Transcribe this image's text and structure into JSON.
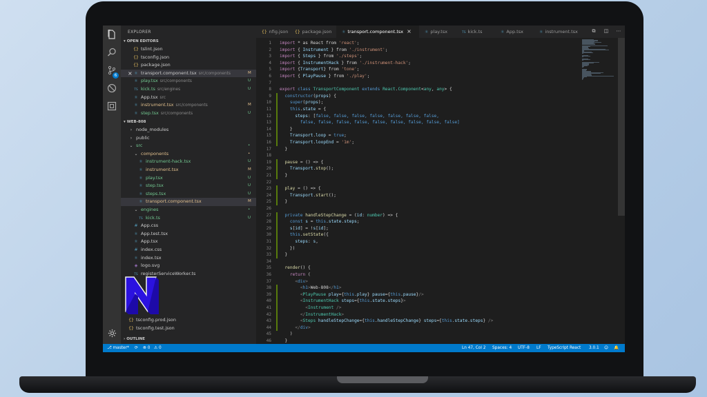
{
  "sidebar": {
    "title": "EXPLORER",
    "open_editors_label": "OPEN EDITORS",
    "open_editors": [
      {
        "icon": "{}",
        "name": "tslint.json",
        "desc": "",
        "status": "",
        "sel": false,
        "color": ""
      },
      {
        "icon": "{}",
        "name": "tsconfig.json",
        "desc": "",
        "status": "",
        "sel": false,
        "color": ""
      },
      {
        "icon": "{}",
        "name": "package.json",
        "desc": "",
        "status": "",
        "sel": false,
        "color": ""
      },
      {
        "icon": "⚛",
        "name": "transport.component.tsx",
        "desc": "src/components",
        "status": "M",
        "sel": true,
        "color": ""
      },
      {
        "icon": "⚛",
        "name": "play.tsx",
        "desc": "src/components",
        "status": "U",
        "sel": false,
        "color": "green"
      },
      {
        "icon": "TS",
        "name": "kick.ts",
        "desc": "src/engines",
        "status": "U",
        "sel": false,
        "color": "green"
      },
      {
        "icon": "⚛",
        "name": "App.tsx",
        "desc": "src",
        "status": "",
        "sel": false,
        "color": ""
      },
      {
        "icon": "⚛",
        "name": "instrument.tsx",
        "desc": "src/components",
        "status": "M",
        "sel": false,
        "color": "orange"
      },
      {
        "icon": "⚛",
        "name": "step.tsx",
        "desc": "src/components",
        "status": "U",
        "sel": false,
        "color": "green"
      }
    ],
    "project_label": "WEB-808",
    "tree": [
      {
        "indent": 1,
        "icon": "›",
        "name": "node_modules",
        "status": "",
        "color": ""
      },
      {
        "indent": 1,
        "icon": "›",
        "name": "public",
        "status": "",
        "color": ""
      },
      {
        "indent": 1,
        "icon": "⌄",
        "name": "src",
        "status": "•",
        "color": "green"
      },
      {
        "indent": 2,
        "icon": "⌄",
        "name": "components",
        "status": "•",
        "color": "orange"
      },
      {
        "indent": 3,
        "icon": "⚛",
        "name": "instrument-hack.tsx",
        "status": "U",
        "color": "green"
      },
      {
        "indent": 3,
        "icon": "⚛",
        "name": "instrument.tsx",
        "status": "M",
        "color": "orange"
      },
      {
        "indent": 3,
        "icon": "⚛",
        "name": "play.tsx",
        "status": "U",
        "color": "green"
      },
      {
        "indent": 3,
        "icon": "⚛",
        "name": "step.tsx",
        "status": "U",
        "color": "green"
      },
      {
        "indent": 3,
        "icon": "⚛",
        "name": "steps.tsx",
        "status": "U",
        "color": "green"
      },
      {
        "indent": 3,
        "icon": "⚛",
        "name": "transport.component.tsx",
        "status": "M",
        "color": "orange",
        "sel": true
      },
      {
        "indent": 2,
        "icon": "⌄",
        "name": "engines",
        "status": "•",
        "color": "green"
      },
      {
        "indent": 3,
        "icon": "TS",
        "name": "kick.ts",
        "status": "U",
        "color": "green"
      },
      {
        "indent": 2,
        "icon": "#",
        "name": "App.css",
        "status": "",
        "color": ""
      },
      {
        "indent": 2,
        "icon": "⚛",
        "name": "App.test.tsx",
        "status": "",
        "color": ""
      },
      {
        "indent": 2,
        "icon": "⚛",
        "name": "App.tsx",
        "status": "",
        "color": ""
      },
      {
        "indent": 2,
        "icon": "#",
        "name": "index.css",
        "status": "",
        "color": ""
      },
      {
        "indent": 2,
        "icon": "⚛",
        "name": "index.tsx",
        "status": "",
        "color": ""
      },
      {
        "indent": 2,
        "icon": "◈",
        "name": "logo.svg",
        "status": "",
        "color": ""
      },
      {
        "indent": 2,
        "icon": "TS",
        "name": "registerServiceWorker.ts",
        "status": "",
        "color": ""
      }
    ],
    "tree_bottom": [
      {
        "indent": 1,
        "icon": "{}",
        "name": "tsconfig.prod.json",
        "status": "",
        "color": ""
      },
      {
        "indent": 1,
        "icon": "{}",
        "name": "tsconfig.test.json",
        "status": "",
        "color": ""
      }
    ],
    "outline_label": "OUTLINE"
  },
  "tabs": [
    {
      "icon": "{}",
      "label": "nfig.json",
      "active": false,
      "ts": false
    },
    {
      "icon": "{}",
      "label": "package.json",
      "active": false,
      "ts": false
    },
    {
      "icon": "⚛",
      "label": "transport.component.tsx",
      "active": true,
      "ts": true,
      "close": "×"
    },
    {
      "icon": "⚛",
      "label": "play.tsx",
      "active": false,
      "ts": true
    },
    {
      "icon": "TS",
      "label": "kick.ts",
      "active": false,
      "ts": true
    },
    {
      "icon": "⚛",
      "label": "App.tsx",
      "active": false,
      "ts": true
    },
    {
      "icon": "⚛",
      "label": "instrument.tsx",
      "active": false,
      "ts": true
    }
  ],
  "code_lines": [
    [
      [
        "import",
        "#c586c0"
      ],
      [
        " * as React from ",
        "#d4d4d4"
      ],
      [
        "'react'",
        "#ce9178"
      ],
      [
        ";",
        "#d4d4d4"
      ]
    ],
    [
      [
        "import",
        "#c586c0"
      ],
      [
        " { ",
        "#d4d4d4"
      ],
      [
        "Instrument",
        "#9cdcfe"
      ],
      [
        " } from ",
        "#d4d4d4"
      ],
      [
        "'./instrument'",
        "#ce9178"
      ],
      [
        ";",
        "#d4d4d4"
      ]
    ],
    [
      [
        "import",
        "#c586c0"
      ],
      [
        " { ",
        "#d4d4d4"
      ],
      [
        "Steps",
        "#9cdcfe"
      ],
      [
        " } from ",
        "#d4d4d4"
      ],
      [
        "'./steps'",
        "#ce9178"
      ],
      [
        ";",
        "#d4d4d4"
      ]
    ],
    [
      [
        "import",
        "#c586c0"
      ],
      [
        " { ",
        "#d4d4d4"
      ],
      [
        "InstrumentHack",
        "#9cdcfe"
      ],
      [
        " } from ",
        "#d4d4d4"
      ],
      [
        "'./instrument-hack'",
        "#ce9178"
      ],
      [
        ";",
        "#d4d4d4"
      ]
    ],
    [
      [
        "import",
        "#c586c0"
      ],
      [
        " {",
        "#d4d4d4"
      ],
      [
        "Transport",
        "#9cdcfe"
      ],
      [
        "} from ",
        "#d4d4d4"
      ],
      [
        "'tone'",
        "#ce9178"
      ],
      [
        ";",
        "#d4d4d4"
      ]
    ],
    [
      [
        "import",
        "#c586c0"
      ],
      [
        " { ",
        "#d4d4d4"
      ],
      [
        "PlayPause",
        "#9cdcfe"
      ],
      [
        " } from ",
        "#d4d4d4"
      ],
      [
        "'./play'",
        "#ce9178"
      ],
      [
        ";",
        "#d4d4d4"
      ]
    ],
    [],
    [
      [
        "export",
        "#c586c0"
      ],
      [
        " ",
        "#d4d4d4"
      ],
      [
        "class",
        "#569cd6"
      ],
      [
        " ",
        "#d4d4d4"
      ],
      [
        "TransportComponent",
        "#4ec9b0"
      ],
      [
        " ",
        "#d4d4d4"
      ],
      [
        "extends",
        "#569cd6"
      ],
      [
        " ",
        "#d4d4d4"
      ],
      [
        "React",
        "#4ec9b0"
      ],
      [
        ".",
        "#d4d4d4"
      ],
      [
        "Component",
        "#4ec9b0"
      ],
      [
        "<",
        "#d4d4d4"
      ],
      [
        "any",
        "#4ec9b0"
      ],
      [
        ", ",
        "#d4d4d4"
      ],
      [
        "any",
        "#4ec9b0"
      ],
      [
        "> {",
        "#d4d4d4"
      ]
    ],
    [
      [
        "  ",
        "#d4d4d4"
      ],
      [
        "constructor",
        "#569cd6"
      ],
      [
        "(",
        "#d4d4d4"
      ],
      [
        "props",
        "#9cdcfe"
      ],
      [
        ") {",
        "#d4d4d4"
      ]
    ],
    [
      [
        "    ",
        "#d4d4d4"
      ],
      [
        "super",
        "#569cd6"
      ],
      [
        "(",
        "#d4d4d4"
      ],
      [
        "props",
        "#9cdcfe"
      ],
      [
        ");",
        "#d4d4d4"
      ]
    ],
    [
      [
        "    ",
        "#d4d4d4"
      ],
      [
        "this",
        "#569cd6"
      ],
      [
        ".",
        "#d4d4d4"
      ],
      [
        "state",
        "#9cdcfe"
      ],
      [
        " = {",
        "#d4d4d4"
      ]
    ],
    [
      [
        "      ",
        "#d4d4d4"
      ],
      [
        "steps",
        "#9cdcfe"
      ],
      [
        ": [",
        "#d4d4d4"
      ],
      [
        "false, false, false, false, false, false, false,",
        "#569cd6"
      ]
    ],
    [
      [
        "        ",
        "#d4d4d4"
      ],
      [
        "false, false, false, false, false, false, false, false, false]",
        "#569cd6"
      ]
    ],
    [
      [
        "    }",
        "#d4d4d4"
      ]
    ],
    [
      [
        "    ",
        "#d4d4d4"
      ],
      [
        "Transport",
        "#9cdcfe"
      ],
      [
        ".",
        "#d4d4d4"
      ],
      [
        "loop",
        "#9cdcfe"
      ],
      [
        " = ",
        "#d4d4d4"
      ],
      [
        "true",
        "#569cd6"
      ],
      [
        ";",
        "#d4d4d4"
      ]
    ],
    [
      [
        "    ",
        "#d4d4d4"
      ],
      [
        "Transport",
        "#9cdcfe"
      ],
      [
        ".",
        "#d4d4d4"
      ],
      [
        "loopEnd",
        "#9cdcfe"
      ],
      [
        " = ",
        "#d4d4d4"
      ],
      [
        "'1m'",
        "#ce9178"
      ],
      [
        ";",
        "#d4d4d4"
      ]
    ],
    [
      [
        "  }",
        "#d4d4d4"
      ]
    ],
    [],
    [
      [
        "  ",
        "#d4d4d4"
      ],
      [
        "pause",
        "#dcdcaa"
      ],
      [
        " = () => {",
        "#d4d4d4"
      ]
    ],
    [
      [
        "    ",
        "#d4d4d4"
      ],
      [
        "Transport",
        "#9cdcfe"
      ],
      [
        ".",
        "#d4d4d4"
      ],
      [
        "stop",
        "#dcdcaa"
      ],
      [
        "();",
        "#d4d4d4"
      ]
    ],
    [
      [
        "  }",
        "#d4d4d4"
      ]
    ],
    [],
    [
      [
        "  ",
        "#d4d4d4"
      ],
      [
        "play",
        "#dcdcaa"
      ],
      [
        " = () => {",
        "#d4d4d4"
      ]
    ],
    [
      [
        "    ",
        "#d4d4d4"
      ],
      [
        "Transport",
        "#9cdcfe"
      ],
      [
        ".",
        "#d4d4d4"
      ],
      [
        "start",
        "#dcdcaa"
      ],
      [
        "();",
        "#d4d4d4"
      ]
    ],
    [
      [
        "  }",
        "#d4d4d4"
      ]
    ],
    [],
    [
      [
        "  ",
        "#d4d4d4"
      ],
      [
        "private",
        "#569cd6"
      ],
      [
        " ",
        "#d4d4d4"
      ],
      [
        "handleStepChange",
        "#dcdcaa"
      ],
      [
        " = (",
        "#d4d4d4"
      ],
      [
        "id",
        "#9cdcfe"
      ],
      [
        ": ",
        "#d4d4d4"
      ],
      [
        "number",
        "#4ec9b0"
      ],
      [
        ") => {",
        "#d4d4d4"
      ]
    ],
    [
      [
        "    ",
        "#d4d4d4"
      ],
      [
        "const",
        "#569cd6"
      ],
      [
        " ",
        "#d4d4d4"
      ],
      [
        "s",
        "#9cdcfe"
      ],
      [
        " = ",
        "#d4d4d4"
      ],
      [
        "this",
        "#569cd6"
      ],
      [
        ".",
        "#d4d4d4"
      ],
      [
        "state",
        "#9cdcfe"
      ],
      [
        ".",
        "#d4d4d4"
      ],
      [
        "steps",
        "#9cdcfe"
      ],
      [
        ";",
        "#d4d4d4"
      ]
    ],
    [
      [
        "    ",
        "#d4d4d4"
      ],
      [
        "s",
        "#9cdcfe"
      ],
      [
        "[",
        "#d4d4d4"
      ],
      [
        "id",
        "#9cdcfe"
      ],
      [
        "] = !",
        "#d4d4d4"
      ],
      [
        "s",
        "#9cdcfe"
      ],
      [
        "[",
        "#d4d4d4"
      ],
      [
        "id",
        "#9cdcfe"
      ],
      [
        "];",
        "#d4d4d4"
      ]
    ],
    [
      [
        "    ",
        "#d4d4d4"
      ],
      [
        "this",
        "#569cd6"
      ],
      [
        ".",
        "#d4d4d4"
      ],
      [
        "setState",
        "#dcdcaa"
      ],
      [
        "({",
        "#d4d4d4"
      ]
    ],
    [
      [
        "      ",
        "#d4d4d4"
      ],
      [
        "steps",
        "#9cdcfe"
      ],
      [
        ": ",
        "#d4d4d4"
      ],
      [
        "s",
        "#9cdcfe"
      ],
      [
        ",",
        "#d4d4d4"
      ]
    ],
    [
      [
        "    })",
        "#d4d4d4"
      ]
    ],
    [
      [
        "  }",
        "#d4d4d4"
      ]
    ],
    [],
    [
      [
        "  ",
        "#d4d4d4"
      ],
      [
        "render",
        "#dcdcaa"
      ],
      [
        "() {",
        "#d4d4d4"
      ]
    ],
    [
      [
        "    ",
        "#d4d4d4"
      ],
      [
        "return",
        "#c586c0"
      ],
      [
        " (",
        "#d4d4d4"
      ]
    ],
    [
      [
        "      ",
        "#d4d4d4"
      ],
      [
        "<",
        "#808080"
      ],
      [
        "div",
        "#569cd6"
      ],
      [
        ">",
        "#808080"
      ]
    ],
    [
      [
        "        ",
        "#d4d4d4"
      ],
      [
        "<",
        "#808080"
      ],
      [
        "h1",
        "#569cd6"
      ],
      [
        ">",
        "#808080"
      ],
      [
        "Web-808",
        "#d4d4d4"
      ],
      [
        "</",
        "#808080"
      ],
      [
        "h1",
        "#569cd6"
      ],
      [
        ">",
        "#808080"
      ]
    ],
    [
      [
        "        ",
        "#d4d4d4"
      ],
      [
        "<",
        "#808080"
      ],
      [
        "PlayPause",
        "#4ec9b0"
      ],
      [
        " ",
        "#d4d4d4"
      ],
      [
        "play",
        "#9cdcfe"
      ],
      [
        "={",
        "#d4d4d4"
      ],
      [
        "this",
        "#569cd6"
      ],
      [
        ".",
        "#d4d4d4"
      ],
      [
        "play",
        "#9cdcfe"
      ],
      [
        "} ",
        "#d4d4d4"
      ],
      [
        "pause",
        "#9cdcfe"
      ],
      [
        "={",
        "#d4d4d4"
      ],
      [
        "this",
        "#569cd6"
      ],
      [
        ".",
        "#d4d4d4"
      ],
      [
        "pause",
        "#9cdcfe"
      ],
      [
        "}",
        "#d4d4d4"
      ],
      [
        "/>",
        "#808080"
      ]
    ],
    [
      [
        "        ",
        "#d4d4d4"
      ],
      [
        "<",
        "#808080"
      ],
      [
        "InstrumentHack",
        "#4ec9b0"
      ],
      [
        " ",
        "#d4d4d4"
      ],
      [
        "steps",
        "#9cdcfe"
      ],
      [
        "={",
        "#d4d4d4"
      ],
      [
        "this",
        "#569cd6"
      ],
      [
        ".",
        "#d4d4d4"
      ],
      [
        "state",
        "#9cdcfe"
      ],
      [
        ".",
        "#d4d4d4"
      ],
      [
        "steps",
        "#9cdcfe"
      ],
      [
        "}",
        "#d4d4d4"
      ],
      [
        ">",
        "#808080"
      ]
    ],
    [
      [
        "          ",
        "#d4d4d4"
      ],
      [
        "<",
        "#808080"
      ],
      [
        "Instrument",
        "#4ec9b0"
      ],
      [
        " ",
        "#d4d4d4"
      ],
      [
        "/>",
        "#808080"
      ]
    ],
    [
      [
        "        ",
        "#d4d4d4"
      ],
      [
        "</",
        "#808080"
      ],
      [
        "InstrumentHack",
        "#4ec9b0"
      ],
      [
        ">",
        "#808080"
      ]
    ],
    [
      [
        "        ",
        "#d4d4d4"
      ],
      [
        "<",
        "#808080"
      ],
      [
        "Steps",
        "#4ec9b0"
      ],
      [
        " ",
        "#d4d4d4"
      ],
      [
        "handleStepChange",
        "#9cdcfe"
      ],
      [
        "={",
        "#d4d4d4"
      ],
      [
        "this",
        "#569cd6"
      ],
      [
        ".",
        "#d4d4d4"
      ],
      [
        "handleStepChange",
        "#9cdcfe"
      ],
      [
        "} ",
        "#d4d4d4"
      ],
      [
        "steps",
        "#9cdcfe"
      ],
      [
        "={",
        "#d4d4d4"
      ],
      [
        "this",
        "#569cd6"
      ],
      [
        ".",
        "#d4d4d4"
      ],
      [
        "state",
        "#9cdcfe"
      ],
      [
        ".",
        "#d4d4d4"
      ],
      [
        "steps",
        "#9cdcfe"
      ],
      [
        "} ",
        "#d4d4d4"
      ],
      [
        "/>",
        "#808080"
      ]
    ],
    [
      [
        "      ",
        "#d4d4d4"
      ],
      [
        "</",
        "#808080"
      ],
      [
        "div",
        "#569cd6"
      ],
      [
        ">",
        "#808080"
      ]
    ],
    [
      [
        "    )",
        "#d4d4d4"
      ]
    ],
    [
      [
        "  }",
        "#d4d4d4"
      ]
    ],
    [
      [
        "}",
        "#d4d4d4"
      ]
    ]
  ],
  "status": {
    "branch": "master*",
    "sync": "⟳",
    "errors": "⊗ 0",
    "warnings": "⚠ 0",
    "position": "Ln 47, Col 2",
    "spaces": "Spaces: 4",
    "encoding": "UTF-8",
    "eol": "LF",
    "language": "TypeScript React",
    "version": "3.0.1",
    "feedback": "☺",
    "bell": "🔔"
  },
  "activity_icons": [
    "files-icon",
    "search-icon",
    "source-control-icon",
    "debug-icon",
    "extensions-icon"
  ],
  "scm_badge": "6",
  "colors": {
    "accent": "#007acc",
    "logo_fill": "#2b12e0",
    "logo_stroke": "#f2f2f2"
  }
}
